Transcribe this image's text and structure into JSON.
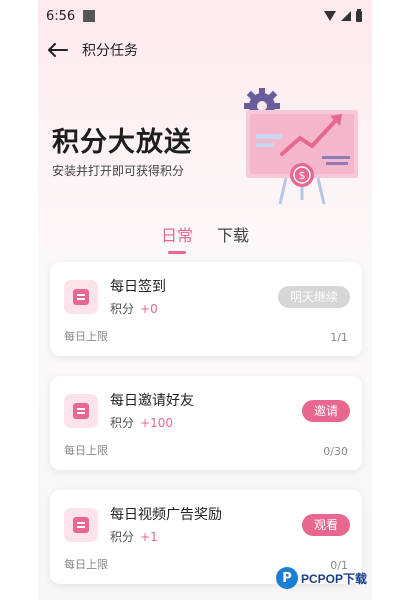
{
  "status_bar": {
    "time": "6:56"
  },
  "header": {
    "title": "积分任务"
  },
  "hero": {
    "title": "积分大放送",
    "subtitle": "安装并打开即可获得积分"
  },
  "tabs": [
    {
      "label": "日常",
      "active": true
    },
    {
      "label": "下载",
      "active": false
    }
  ],
  "tasks": [
    {
      "name": "每日签到",
      "points_label": "积分",
      "points": "+0",
      "action": "明天继续",
      "action_state": "disabled",
      "limit_label": "每日上限",
      "count": "1/1"
    },
    {
      "name": "每日邀请好友",
      "points_label": "积分",
      "points": "+100",
      "action": "邀请",
      "action_state": "active",
      "limit_label": "每日上限",
      "count": "0/30"
    },
    {
      "name": "每日视频广告奖励",
      "points_label": "积分",
      "points": "+1",
      "action": "观看",
      "action_state": "active",
      "limit_label": "每日上限",
      "count": "0/1"
    }
  ],
  "watermark": {
    "logo": "P",
    "text": "PCPOP下载"
  },
  "colors": {
    "accent": "#e8678f",
    "disabled": "#d6d6d6",
    "icon_bg": "#fce3ea"
  }
}
